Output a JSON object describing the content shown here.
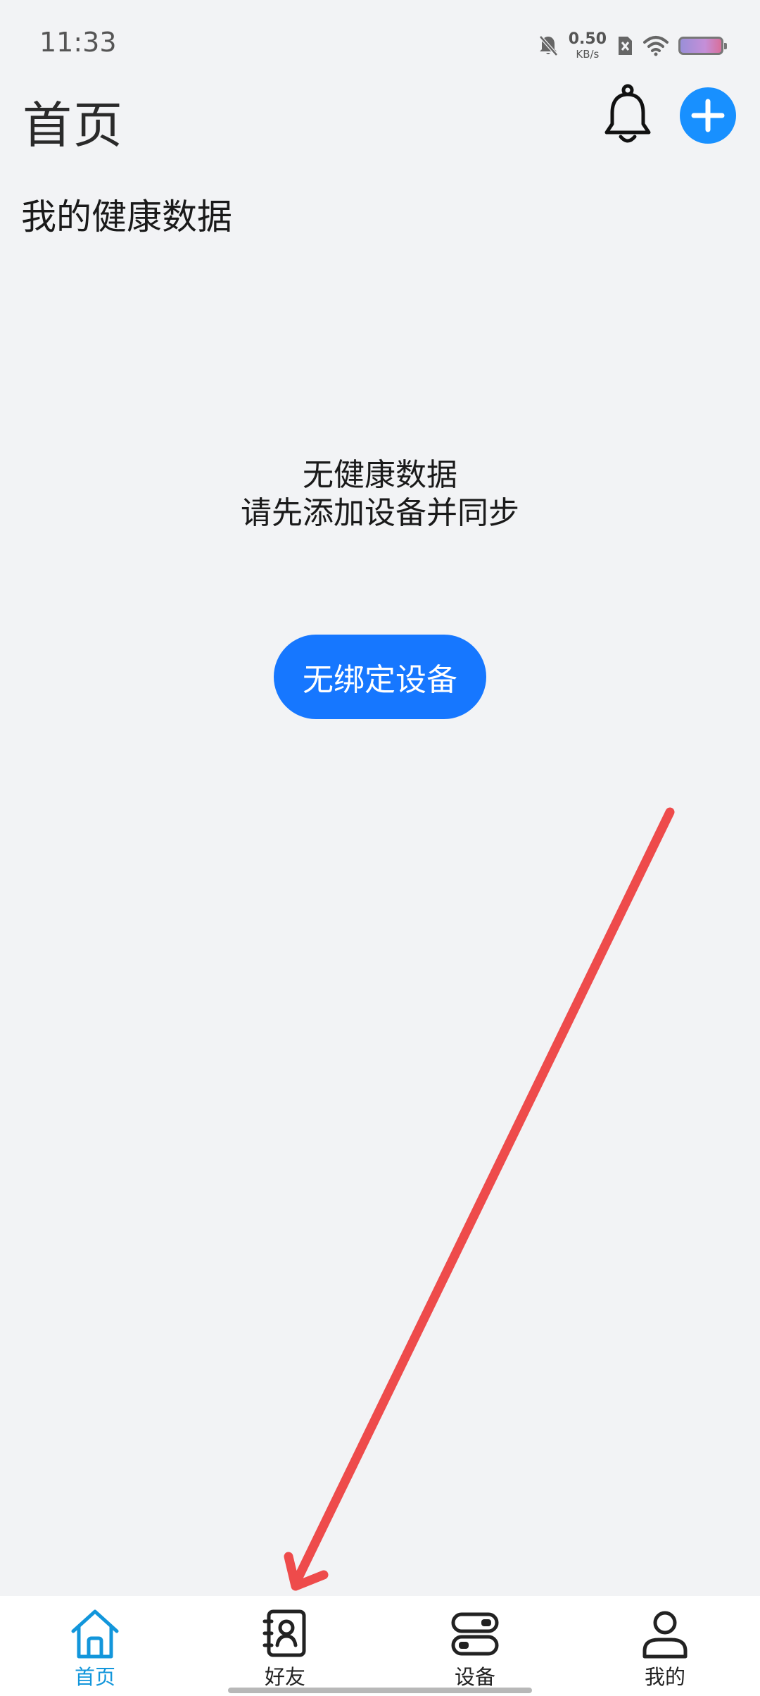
{
  "status_bar": {
    "time": "11:33",
    "net_speed_value": "0.50",
    "net_speed_unit": "KB/s",
    "icons": [
      "mute-bell-icon",
      "sim-off-icon",
      "wifi-icon",
      "battery-icon"
    ]
  },
  "header": {
    "title": "首页",
    "notification_icon": "bell-icon",
    "add_icon": "plus-icon"
  },
  "section": {
    "title": "我的健康数据"
  },
  "empty_state": {
    "line1": "无健康数据",
    "line2": "请先添加设备并同步",
    "button_label": "无绑定设备"
  },
  "bottom_nav": {
    "items": [
      {
        "label": "首页",
        "icon": "home-icon",
        "active": true
      },
      {
        "label": "好友",
        "icon": "contacts-book-icon",
        "active": false
      },
      {
        "label": "设备",
        "icon": "device-toggle-icon",
        "active": false
      },
      {
        "label": "我的",
        "icon": "person-icon",
        "active": false
      }
    ]
  },
  "colors": {
    "accent": "#1677ff",
    "add_button": "#1890ff",
    "active_tab": "#1296db",
    "background": "#f2f3f5",
    "annotation_arrow": "#ee4b4b"
  }
}
